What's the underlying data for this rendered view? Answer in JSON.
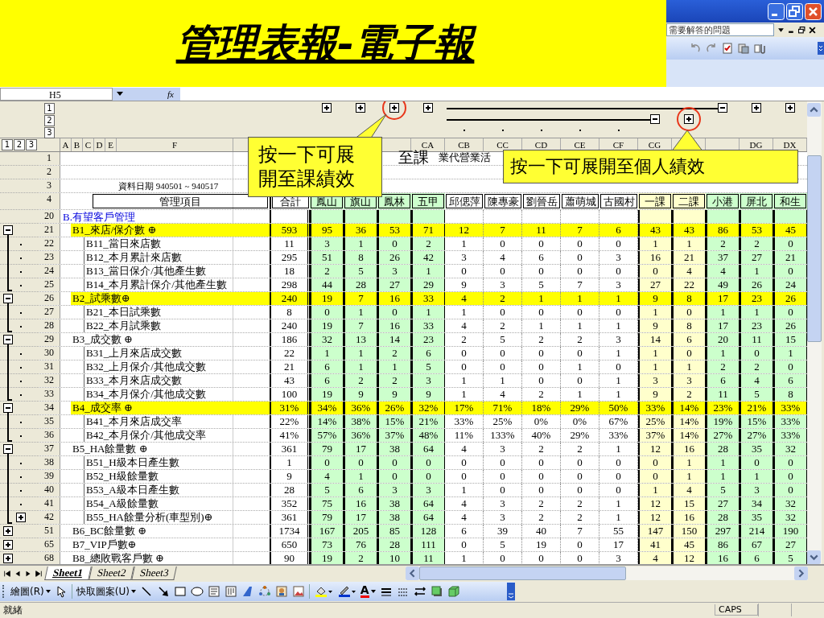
{
  "slide_title": "管理表報-電子報",
  "excel": {
    "help_field": {
      "placeholder": "需要解答的問題"
    },
    "name_box": "H5",
    "formula_label": "fx"
  },
  "sheet": {
    "column_levels": [
      "1",
      "2",
      "3"
    ],
    "row_levels": [
      "1",
      "2",
      "3"
    ],
    "left_letters": [
      "A",
      "B",
      "C",
      "D",
      "E",
      "F"
    ],
    "columns": [
      {
        "kind": "total",
        "heading": "合計"
      },
      {
        "kind": "green",
        "heading": "鳳山",
        "outline": {
          "kind": "branch-expand",
          "circled": false
        }
      },
      {
        "kind": "green",
        "heading": "旗山",
        "outline": {
          "kind": "branch-expand",
          "circled": false
        }
      },
      {
        "kind": "green",
        "heading": "鳳林",
        "outline": {
          "kind": "branch-expand",
          "circled": true
        }
      },
      {
        "kind": "green",
        "letter": "CA",
        "heading": "五甲",
        "outline": {
          "kind": "branch-expand",
          "circled": false
        }
      },
      {
        "kind": "person",
        "letter": "CB",
        "heading": "邱偲萍",
        "outline": {
          "kind": "member-dot",
          "circled": false
        }
      },
      {
        "kind": "person",
        "letter": "CC",
        "heading": "陳專豪",
        "outline": {
          "kind": "member-dot",
          "circled": false
        }
      },
      {
        "kind": "person",
        "letter": "CD",
        "heading": "劉晉岳",
        "outline": {
          "kind": "member-dot",
          "circled": false
        }
      },
      {
        "kind": "person",
        "letter": "CE",
        "heading": "蕭萌城",
        "outline": {
          "kind": "member-dot",
          "circled": false
        }
      },
      {
        "kind": "person",
        "letter": "CF",
        "heading": "古國村",
        "outline": {
          "kind": "member-dot",
          "circled": false
        }
      },
      {
        "kind": "yellow",
        "letter": "CG",
        "heading": "一課",
        "outline": {
          "kind": "team-collapse",
          "circled": false
        }
      },
      {
        "kind": "yellow",
        "heading": "二課",
        "outline": {
          "kind": "team-expand",
          "circled": true
        }
      },
      {
        "kind": "green",
        "heading": "小港",
        "outline": {
          "kind": "branch-collapse",
          "circled": false
        }
      },
      {
        "kind": "green",
        "letter": "DG",
        "heading": "屏北",
        "outline": {
          "kind": "branch-expand",
          "circled": false
        }
      },
      {
        "kind": "green",
        "letter": "DX",
        "heading": "和生",
        "outline": {
          "kind": "branch-expand",
          "circled": false
        }
      }
    ],
    "header_rows": [
      {
        "row_number": "1",
        "kind": "title",
        "fragments": [
          "至課",
          "業代營業活"
        ]
      },
      {
        "row_number": "2",
        "kind": "blank"
      },
      {
        "row_number": "3",
        "kind": "date",
        "label": "資料日期 940501 ~ 940517"
      },
      {
        "row_number": "4",
        "kind": "headings",
        "label": "管理項目"
      }
    ],
    "section": {
      "row_number": "20",
      "label": "B.有望客戶管理"
    },
    "items": [
      {
        "row_number": "21",
        "label": "B1_來店/保介數 ⊕",
        "highlight": true,
        "expanded": true,
        "values": [
          "593",
          "95",
          "36",
          "53",
          "71",
          "12",
          "7",
          "11",
          "7",
          "6",
          "43",
          "43",
          "86",
          "53",
          "45"
        ],
        "children": [
          {
            "row_number": "22",
            "label": "B11_當日來店數",
            "values": [
              "11",
              "3",
              "1",
              "0",
              "2",
              "1",
              "0",
              "0",
              "0",
              "0",
              "1",
              "1",
              "2",
              "2",
              "0"
            ]
          },
          {
            "row_number": "23",
            "label": "B12_本月累計來店數",
            "values": [
              "295",
              "51",
              "8",
              "26",
              "42",
              "3",
              "4",
              "6",
              "0",
              "3",
              "16",
              "21",
              "37",
              "27",
              "21"
            ]
          },
          {
            "row_number": "24",
            "label": "B13_當日保介/其他產生數",
            "values": [
              "18",
              "2",
              "5",
              "3",
              "1",
              "0",
              "0",
              "0",
              "0",
              "0",
              "0",
              "4",
              "4",
              "1",
              "0"
            ]
          },
          {
            "row_number": "25",
            "label": "B14_本月累計保介/其他產生數",
            "values": [
              "298",
              "44",
              "28",
              "27",
              "29",
              "9",
              "3",
              "5",
              "7",
              "3",
              "27",
              "22",
              "49",
              "26",
              "24"
            ]
          }
        ]
      },
      {
        "row_number": "26",
        "label": "B2_試乘數⊕",
        "highlight": true,
        "expanded": true,
        "values": [
          "240",
          "19",
          "7",
          "16",
          "33",
          "4",
          "2",
          "1",
          "1",
          "1",
          "9",
          "8",
          "17",
          "23",
          "26"
        ],
        "children": [
          {
            "row_number": "27",
            "label": "B21_本日試乘數",
            "values": [
              "8",
              "0",
              "1",
              "0",
              "1",
              "1",
              "0",
              "0",
              "0",
              "0",
              "1",
              "0",
              "1",
              "1",
              "0"
            ]
          },
          {
            "row_number": "28",
            "label": "B22_本月試乘數",
            "values": [
              "240",
              "19",
              "7",
              "16",
              "33",
              "4",
              "2",
              "1",
              "1",
              "1",
              "9",
              "8",
              "17",
              "23",
              "26"
            ]
          }
        ]
      },
      {
        "row_number": "29",
        "label": "B3_成交數 ⊕",
        "highlight": false,
        "expanded": true,
        "values": [
          "186",
          "32",
          "13",
          "14",
          "23",
          "2",
          "5",
          "2",
          "2",
          "3",
          "14",
          "6",
          "20",
          "11",
          "15"
        ],
        "children": [
          {
            "row_number": "30",
            "label": "B31_上月來店成交數",
            "values": [
              "22",
              "1",
              "1",
              "2",
              "6",
              "0",
              "0",
              "0",
              "0",
              "1",
              "1",
              "0",
              "1",
              "0",
              "1"
            ]
          },
          {
            "row_number": "31",
            "label": "B32_上月保介/其他成交數",
            "values": [
              "21",
              "6",
              "1",
              "1",
              "5",
              "0",
              "0",
              "0",
              "1",
              "0",
              "1",
              "1",
              "2",
              "2",
              "0"
            ]
          },
          {
            "row_number": "32",
            "label": "B33_本月來店成交數",
            "values": [
              "43",
              "6",
              "2",
              "2",
              "3",
              "1",
              "1",
              "0",
              "0",
              "1",
              "3",
              "3",
              "6",
              "4",
              "6"
            ]
          },
          {
            "row_number": "33",
            "label": "B34_本月保介/其他成交數",
            "values": [
              "100",
              "19",
              "9",
              "9",
              "9",
              "1",
              "4",
              "2",
              "1",
              "1",
              "9",
              "2",
              "11",
              "5",
              "8"
            ]
          }
        ]
      },
      {
        "row_number": "34",
        "label": "B4_成交率 ⊕",
        "highlight": true,
        "expanded": true,
        "values": [
          "31%",
          "34%",
          "36%",
          "26%",
          "32%",
          "17%",
          "71%",
          "18%",
          "29%",
          "50%",
          "33%",
          "14%",
          "23%",
          "21%",
          "33%"
        ],
        "children": [
          {
            "row_number": "35",
            "label": "B41_本月來店成交率",
            "values": [
              "22%",
              "14%",
              "38%",
              "15%",
              "21%",
              "33%",
              "25%",
              "0%",
              "0%",
              "67%",
              "25%",
              "14%",
              "19%",
              "15%",
              "33%"
            ]
          },
          {
            "row_number": "36",
            "label": "B42_本月保介/其他成交率",
            "values": [
              "41%",
              "57%",
              "36%",
              "37%",
              "48%",
              "11%",
              "133%",
              "40%",
              "29%",
              "33%",
              "37%",
              "14%",
              "27%",
              "27%",
              "33%"
            ]
          }
        ]
      },
      {
        "row_number": "37",
        "label": "B5_HA餘量數 ⊕",
        "highlight": false,
        "expanded": true,
        "values": [
          "361",
          "79",
          "17",
          "38",
          "64",
          "4",
          "3",
          "2",
          "2",
          "1",
          "12",
          "16",
          "28",
          "35",
          "32"
        ],
        "children": [
          {
            "row_number": "38",
            "label": "B51_H級本日產生數",
            "values": [
              "1",
              "0",
              "0",
              "0",
              "0",
              "0",
              "0",
              "0",
              "0",
              "0",
              "0",
              "1",
              "1",
              "0",
              "0"
            ]
          },
          {
            "row_number": "39",
            "label": "B52_H級餘量數",
            "values": [
              "9",
              "4",
              "1",
              "0",
              "0",
              "0",
              "0",
              "0",
              "0",
              "0",
              "0",
              "1",
              "1",
              "1",
              "0"
            ]
          },
          {
            "row_number": "40",
            "label": "B53_A級本日產生數",
            "values": [
              "28",
              "5",
              "6",
              "3",
              "3",
              "1",
              "0",
              "0",
              "0",
              "0",
              "1",
              "4",
              "5",
              "3",
              "0"
            ]
          },
          {
            "row_number": "41",
            "label": "B54_A級餘量數",
            "values": [
              "352",
              "75",
              "16",
              "38",
              "64",
              "4",
              "3",
              "2",
              "2",
              "1",
              "12",
              "15",
              "27",
              "34",
              "32"
            ]
          },
          {
            "row_number": "42",
            "label": "B55_HA餘量分析(車型別)⊕",
            "expanded": false,
            "values": [
              "361",
              "79",
              "17",
              "38",
              "64",
              "4",
              "3",
              "2",
              "2",
              "1",
              "12",
              "16",
              "28",
              "35",
              "32"
            ]
          }
        ]
      },
      {
        "row_number": "51",
        "label": "B6_BC餘量數 ⊕",
        "highlight": false,
        "expanded": false,
        "values": [
          "1734",
          "167",
          "205",
          "85",
          "128",
          "6",
          "39",
          "40",
          "7",
          "55",
          "147",
          "150",
          "297",
          "214",
          "190"
        ]
      },
      {
        "row_number": "65",
        "label": "B7_VIP戶數⊕",
        "highlight": false,
        "expanded": false,
        "values": [
          "650",
          "73",
          "76",
          "28",
          "111",
          "0",
          "5",
          "19",
          "0",
          "17",
          "41",
          "45",
          "86",
          "67",
          "27"
        ]
      },
      {
        "row_number": "68",
        "label": "B8_總敗戰客戶數 ⊕",
        "highlight": false,
        "expanded": false,
        "values": [
          "90",
          "19",
          "2",
          "10",
          "11",
          "1",
          "0",
          "0",
          "0",
          "3",
          "4",
          "12",
          "16",
          "6",
          "5"
        ]
      }
    ]
  },
  "callouts": [
    {
      "text": "按一下可展開至課績效",
      "kind": "left"
    },
    {
      "text": "按一下可展開至個人績效",
      "kind": "right"
    }
  ],
  "sheet_tabs": [
    {
      "label": "Sheet1",
      "selected": true
    },
    {
      "label": "Sheet2",
      "selected": false
    },
    {
      "label": "Sheet3",
      "selected": false
    }
  ],
  "drawing_toolbar": {
    "draw_menu": "繪圖(R)",
    "autoshapes_menu": "快取圖案(U)",
    "font_color_glyph": "A"
  },
  "status_bar": {
    "status": "就緒",
    "caps": "CAPS"
  }
}
